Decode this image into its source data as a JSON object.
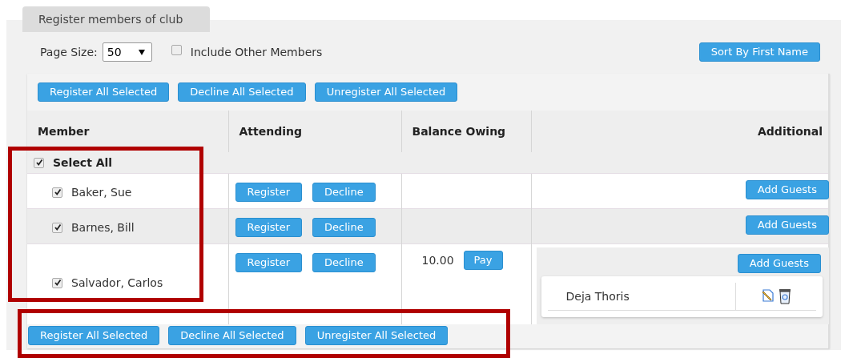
{
  "tab": {
    "label": "Register members of club"
  },
  "page_size": {
    "label": "Page Size:",
    "value": "50"
  },
  "include_other": {
    "label": "Include Other Members",
    "checked": false
  },
  "sort_button": "Sort By First Name",
  "top_actions": [
    "Register All Selected",
    "Decline All Selected",
    "Unregister All Selected"
  ],
  "columns": [
    "Member",
    "Attending",
    "Balance Owing",
    "Additional"
  ],
  "select_all": {
    "label": "Select All",
    "checked": true
  },
  "rows": [
    {
      "name": "Baker, Sue",
      "checked": true,
      "actions": [
        "Register",
        "Decline"
      ],
      "additional_button": "Add Guests"
    },
    {
      "name": "Barnes, Bill",
      "checked": true,
      "actions": [
        "Register",
        "Decline"
      ],
      "additional_button": "Add Guests"
    },
    {
      "name": "Salvador, Carlos",
      "checked": true,
      "actions": [
        "Register",
        "Decline"
      ],
      "balance": "10.00",
      "pay_button": "Pay",
      "additional_button": "Add Guests",
      "guests": [
        {
          "name": "Deja Thoris"
        }
      ]
    }
  ],
  "bottom_actions": [
    "Register All Selected",
    "Decline All Selected",
    "Unregister All Selected"
  ]
}
